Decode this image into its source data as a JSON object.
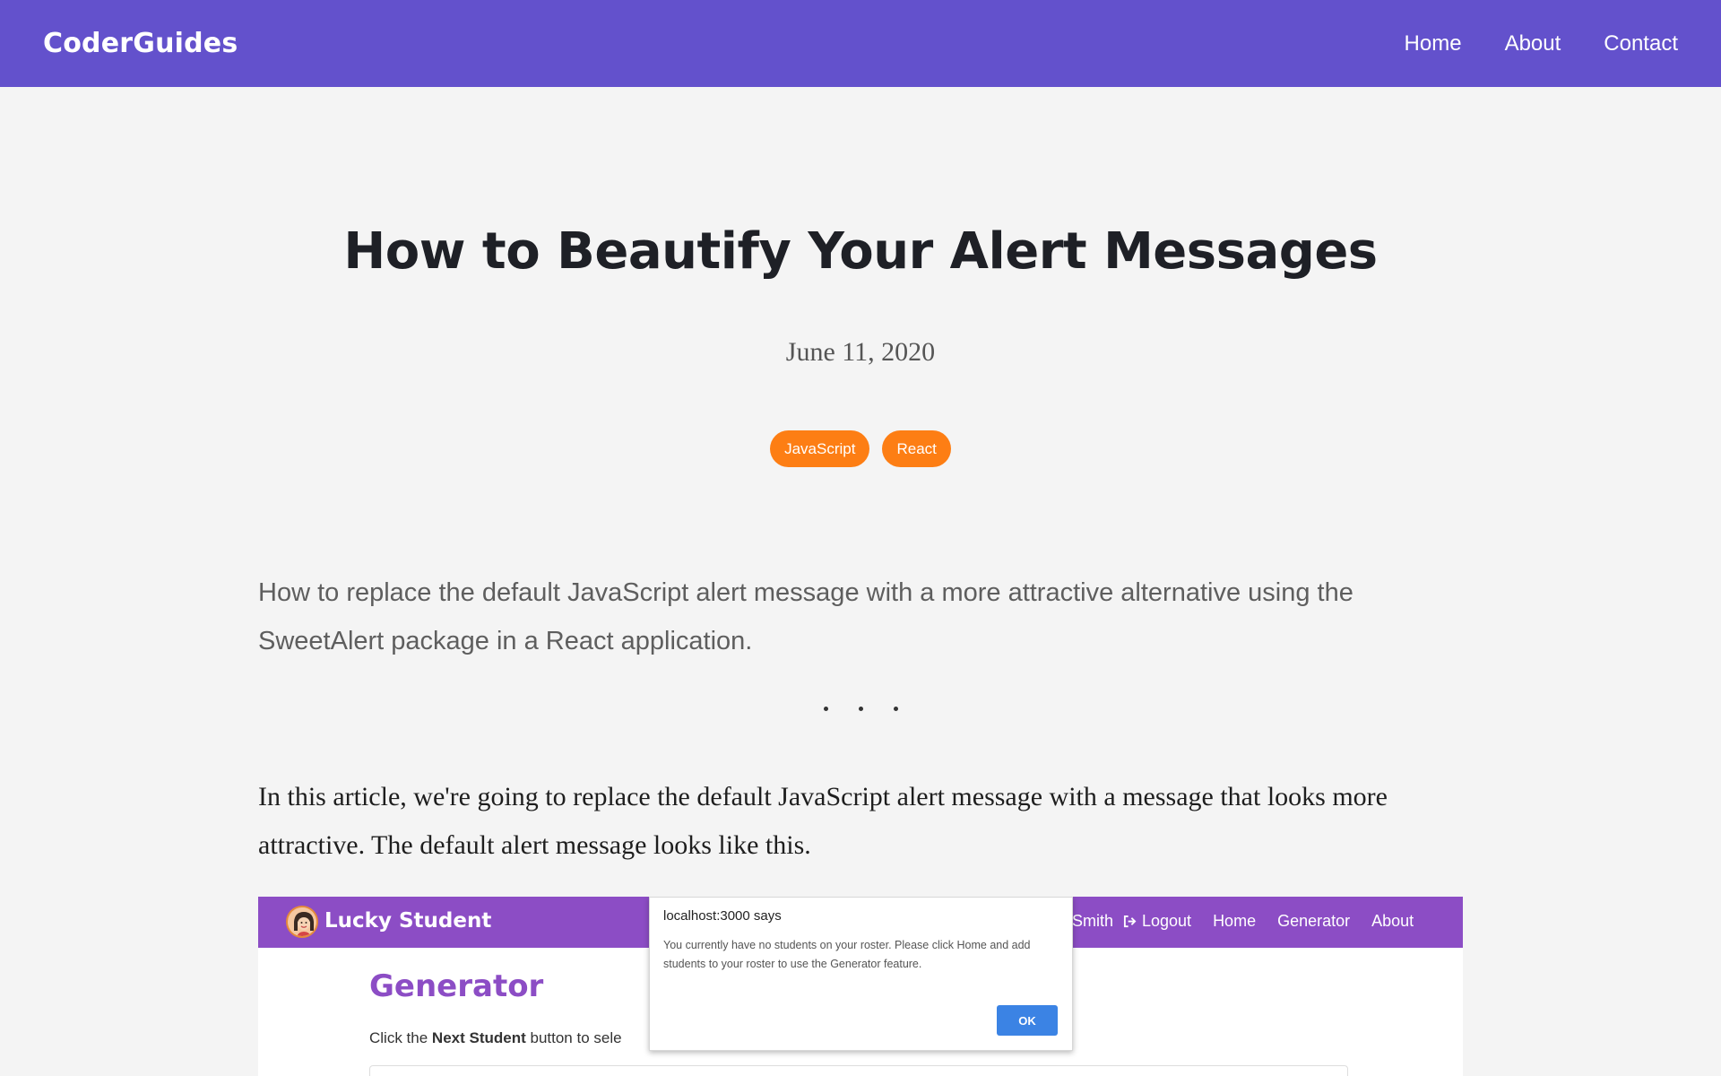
{
  "header": {
    "brand": "CoderGuides",
    "nav": [
      "Home",
      "About",
      "Contact"
    ]
  },
  "post": {
    "title": "How to Beautify Your Alert Messages",
    "date": "June 11, 2020",
    "tags": [
      "JavaScript",
      "React"
    ],
    "lead": "How to replace the default JavaScript alert message with a more attractive alternative using the SweetAlert package in a React application.",
    "body": "In this article, we're going to replace the default JavaScript alert message with a message that looks more attractive. The default alert message looks like this."
  },
  "screenshot": {
    "app_brand": "Lucky Student",
    "user_fragment": "Smith",
    "app_nav": [
      "Logout",
      "Home",
      "Generator",
      "About"
    ],
    "page_heading": "Generator",
    "instructions_prefix": "Click the ",
    "instructions_bold": "Next Student",
    "instructions_suffix": " button to sele",
    "dialog": {
      "title": "localhost:3000 says",
      "message": "You currently have no students on your roster. Please click Home and add students to your roster to use the Generator feature.",
      "ok_label": "OK"
    }
  },
  "colors": {
    "header_bg": "#6351cc",
    "tag_bg": "#fd7e14",
    "app_bar_bg": "#8c4dc5",
    "dialog_button_bg": "#3b83e4"
  },
  "icons": [
    "logout-icon",
    "avatar-icon"
  ]
}
